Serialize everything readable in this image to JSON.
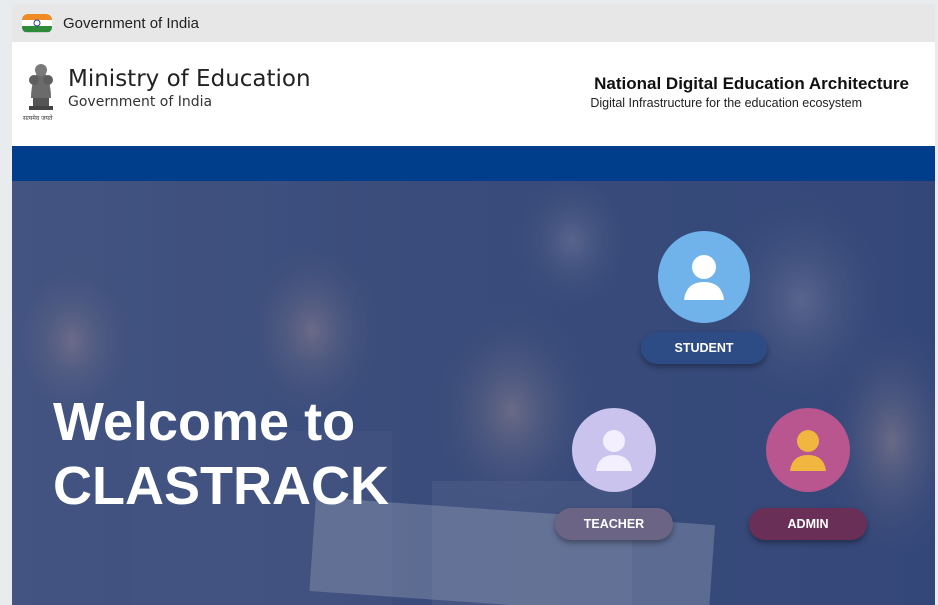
{
  "gov_strip": {
    "text": "Government of India",
    "icon": "india-flag-icon"
  },
  "header": {
    "ministry_title": "Ministry of Education",
    "ministry_subtitle": "Government of India",
    "emblem_caption": "सत्यमेव जयते",
    "ndea_title": "National Digital Education Architecture",
    "ndea_subtitle": "Digital Infrastructure for the education ecosystem"
  },
  "hero": {
    "welcome_line1": "Welcome to",
    "welcome_line2": "CLASTRACK"
  },
  "roles": {
    "student": {
      "label": "STUDENT",
      "icon": "student-avatar-icon",
      "circle_color": "#6fb3ea",
      "pill_color": "#2d4c86"
    },
    "teacher": {
      "label": "TEACHER",
      "icon": "teacher-avatar-icon",
      "circle_color": "#c9c3ee",
      "pill_color": "#6b6485"
    },
    "admin": {
      "label": "ADMIN",
      "icon": "admin-avatar-icon",
      "circle_color": "#b9568f",
      "pill_color": "#6a2f56"
    }
  },
  "colors": {
    "brand_band": "#003d8a",
    "hero_overlay": "#3d4f7c"
  }
}
